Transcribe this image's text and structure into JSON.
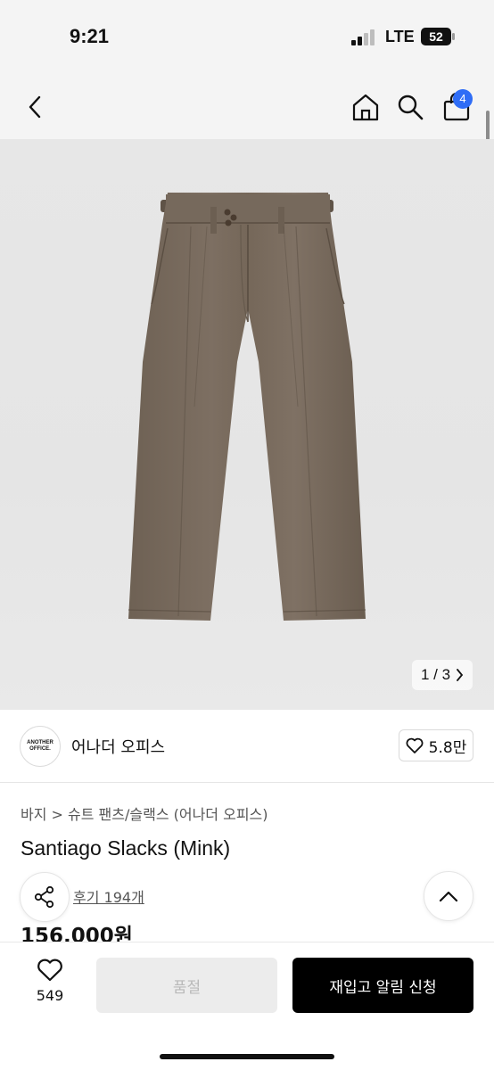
{
  "status_bar": {
    "time": "9:21",
    "network": "LTE",
    "battery": "52"
  },
  "nav": {
    "cart_count": "4"
  },
  "gallery": {
    "pager": "1 / 3",
    "product_color": "#7a6d60"
  },
  "brand": {
    "logo_line1": "ANOTHER",
    "logo_line2": "OFFICE.",
    "name": "어나더 오피스",
    "likes": "5.8만"
  },
  "breadcrumb": "바지 > 슈트 팬츠/슬랙스 (어나더 오피스)",
  "product": {
    "title": "Santiago Slacks (Mink)",
    "reviews": "후기 194개",
    "price": "156,000원"
  },
  "bottom": {
    "wish_count": "549",
    "soldout_label": "품절",
    "restock_label": "재입고 알림 신청"
  },
  "colors": {
    "accent": "#2f6df6",
    "primary_button": "#000000",
    "disabled_button": "#ececec"
  }
}
